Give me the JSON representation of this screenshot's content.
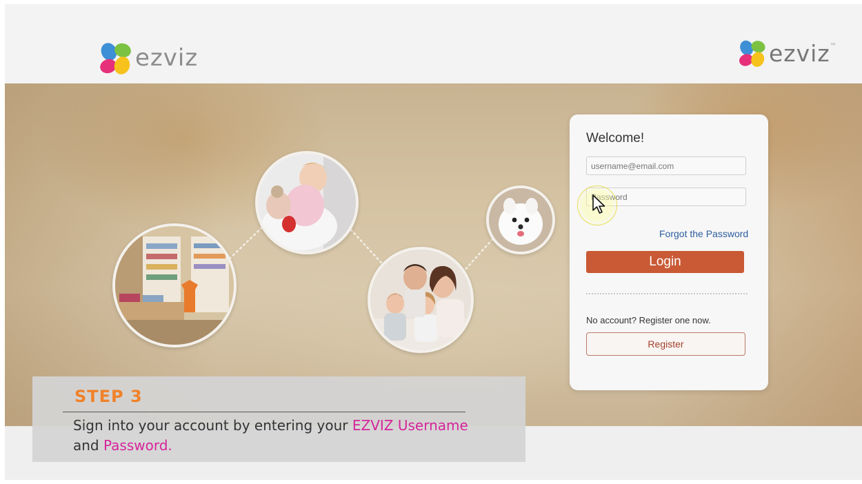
{
  "brand": {
    "name": "ezviz",
    "trademark": "™",
    "colors": {
      "pink": "#e6307a",
      "green": "#7cc242",
      "blue": "#3d8fd6",
      "yellow": "#f6c21b",
      "accent": "#c95a35"
    }
  },
  "login": {
    "welcome": "Welcome!",
    "username_placeholder": "username@email.com",
    "password_placeholder": "Password",
    "forgot_label": "Forgot the Password",
    "login_label": "Login",
    "no_account_text": "No account? Register one now.",
    "register_label": "Register"
  },
  "caption": {
    "step": "STEP 3",
    "text_1": "Sign into your account by entering your ",
    "highlight_1": "EZVIZ Username",
    "text_2": "and ",
    "highlight_2": "Password.",
    "highlight_color": "#d6249b",
    "step_color": "#f0822a"
  },
  "hero_circles": [
    {
      "icon": "clothing-store-photo"
    },
    {
      "icon": "sleeping-baby-photo"
    },
    {
      "icon": "family-photo"
    },
    {
      "icon": "dog-photo"
    }
  ]
}
